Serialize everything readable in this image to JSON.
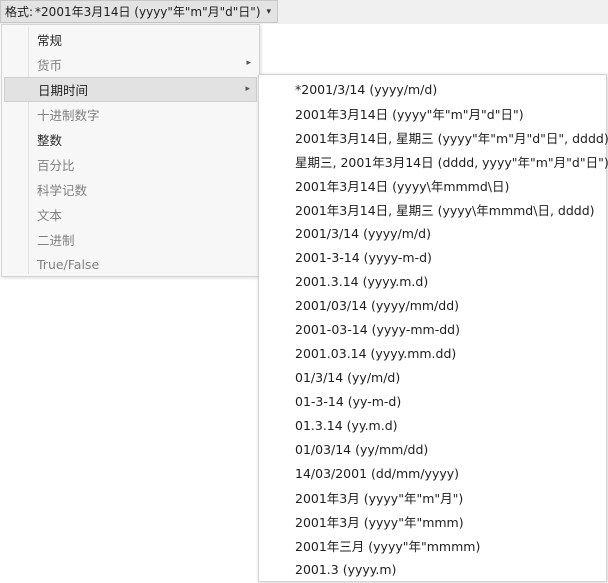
{
  "format_bar": {
    "label": "格式:",
    "value": "*2001年3月14日 (yyyy\"年\"m\"月\"d\"日\")",
    "caret": "▾"
  },
  "main_menu": {
    "arrow": "▸",
    "items": [
      {
        "label": "常规"
      },
      {
        "label": "货币"
      },
      {
        "label": "日期时间"
      },
      {
        "label": "十进制数字"
      },
      {
        "label": "整数"
      },
      {
        "label": "百分比"
      },
      {
        "label": "科学记数"
      },
      {
        "label": "文本"
      },
      {
        "label": "二进制"
      },
      {
        "label": "True/False"
      }
    ]
  },
  "date_submenu": {
    "items": [
      {
        "label": "*2001/3/14 (yyyy/m/d)"
      },
      {
        "label": "2001年3月14日 (yyyy\"年\"m\"月\"d\"日\")"
      },
      {
        "label": "2001年3月14日, 星期三 (yyyy\"年\"m\"月\"d\"日\", dddd)"
      },
      {
        "label": "星期三, 2001年3月14日 (dddd, yyyy\"年\"m\"月\"d\"日\")"
      },
      {
        "label": "2001年3月14日 (yyyy\\年mmmd\\日)"
      },
      {
        "label": "2001年3月14日, 星期三 (yyyy\\年mmmd\\日, dddd)"
      },
      {
        "label": "2001/3/14 (yyyy/m/d)"
      },
      {
        "label": "2001-3-14 (yyyy-m-d)"
      },
      {
        "label": "2001.3.14 (yyyy.m.d)"
      },
      {
        "label": "2001/03/14 (yyyy/mm/dd)"
      },
      {
        "label": "2001-03-14 (yyyy-mm-dd)"
      },
      {
        "label": "2001.03.14 (yyyy.mm.dd)"
      },
      {
        "label": "01/3/14 (yy/m/d)"
      },
      {
        "label": "01-3-14 (yy-m-d)"
      },
      {
        "label": "01.3.14 (yy.m.d)"
      },
      {
        "label": "01/03/14 (yy/mm/dd)"
      },
      {
        "label": "14/03/2001 (dd/mm/yyyy)"
      },
      {
        "label": "2001年3月 (yyyy\"年\"m\"月\")"
      },
      {
        "label": "2001年3月 (yyyy\"年\"mmm)"
      },
      {
        "label": "2001年三月 (yyyy\"年\"mmmm)"
      },
      {
        "label": "2001.3 (yyyy.m)"
      }
    ]
  }
}
